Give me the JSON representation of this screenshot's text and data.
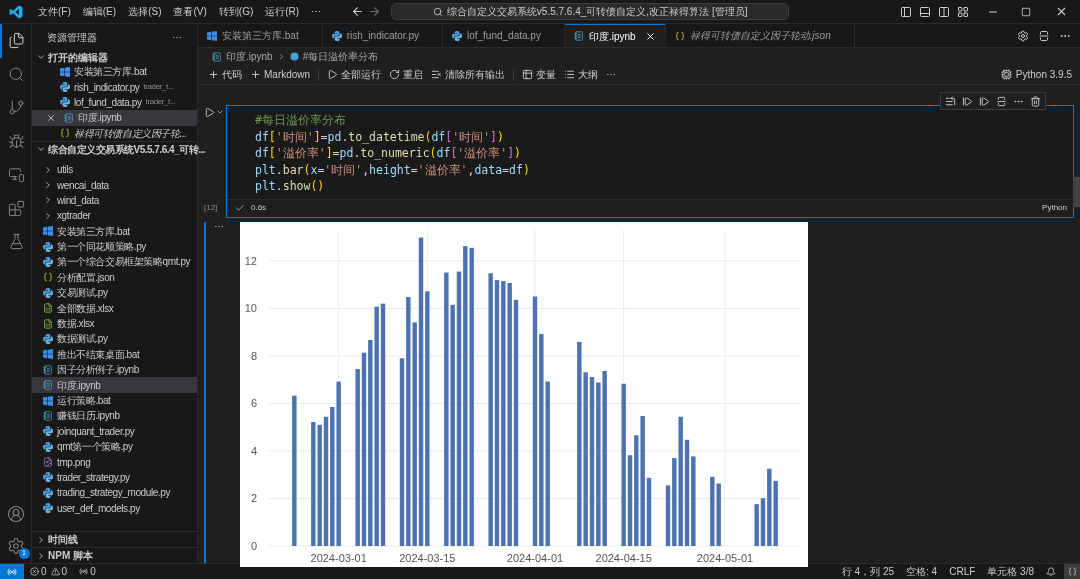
{
  "menu": [
    "文件(F)",
    "编辑(E)",
    "选择(S)",
    "查看(V)",
    "转到(G)",
    "运行(R)",
    "⋯"
  ],
  "command_center": "综合自定义交易系统v5.5.7.6.4_可转债自定义,改正禄得算法 [管理员]",
  "activity_bar": [
    {
      "kind": "explorer",
      "selected": true
    },
    {
      "kind": "search",
      "selected": false
    },
    {
      "kind": "source-control",
      "selected": false
    },
    {
      "kind": "debug",
      "selected": false
    },
    {
      "kind": "remote",
      "selected": false
    },
    {
      "kind": "extensions",
      "selected": false
    },
    {
      "kind": "testing",
      "selected": false
    }
  ],
  "settings_badge": "1",
  "sidebar": {
    "title": "资源管理器",
    "more": "⋯",
    "open_editors": {
      "title": "打开的编辑器",
      "expanded": true,
      "items": [
        {
          "name": "安装第三方库.bat",
          "kind": "bat",
          "selected": false,
          "preview": false
        },
        {
          "name": "rish_indicator.py",
          "detail": "trader_t...",
          "kind": "py",
          "selected": false,
          "preview": false
        },
        {
          "name": "lof_fund_data.py",
          "detail": "trader_t...",
          "kind": "py",
          "selected": false,
          "preview": false
        },
        {
          "name": "印度.ipynb",
          "kind": "ipynb",
          "selected": true,
          "preview": false
        },
        {
          "name": "禄得可转债自定义因子轮...",
          "kind": "json",
          "selected": false,
          "preview": true
        }
      ]
    },
    "project": {
      "title": "综合自定义交易系统V5.5.7.6.4_可转...",
      "expanded": true,
      "items": [
        {
          "name": "utils",
          "kind": "folder",
          "selected": false
        },
        {
          "name": "wencai_data",
          "kind": "folder",
          "selected": false
        },
        {
          "name": "wind_data",
          "kind": "folder",
          "selected": false
        },
        {
          "name": "xgtrader",
          "kind": "folder",
          "selected": false
        },
        {
          "name": "安装第三方库.bat",
          "kind": "bat",
          "selected": false
        },
        {
          "name": "第一个同花顺策略.py",
          "kind": "py",
          "selected": false
        },
        {
          "name": "第一个综合交易框架策略qmt.py",
          "kind": "py",
          "selected": false
        },
        {
          "name": "分析配置.json",
          "kind": "json",
          "selected": false
        },
        {
          "name": "交易测试.py",
          "kind": "py",
          "selected": false
        },
        {
          "name": "全部数据.xlsx",
          "kind": "xlsx",
          "selected": false
        },
        {
          "name": "数据.xlsx",
          "kind": "xlsx",
          "selected": false
        },
        {
          "name": "数据测试.py",
          "kind": "py",
          "selected": false
        },
        {
          "name": "推出不结束桌面.bat",
          "kind": "bat",
          "selected": false
        },
        {
          "name": "因子分析例子.ipynb",
          "kind": "ipynb",
          "selected": false
        },
        {
          "name": "印度.ipynb",
          "kind": "ipynb",
          "selected": true
        },
        {
          "name": "运行策略.bat",
          "kind": "bat",
          "selected": false
        },
        {
          "name": "赚钱日历.ipynb",
          "kind": "ipynb",
          "selected": false
        },
        {
          "name": "joinquant_trader.py",
          "kind": "py",
          "selected": false
        },
        {
          "name": "qmt第一个策略.py",
          "kind": "py",
          "selected": false
        },
        {
          "name": "tmp.png",
          "kind": "png",
          "selected": false
        },
        {
          "name": "trader_strategy.py",
          "kind": "py",
          "selected": false
        },
        {
          "name": "trading_strategy_module.py",
          "kind": "py",
          "selected": false
        },
        {
          "name": "user_def_models.py",
          "kind": "py",
          "selected": false
        }
      ]
    },
    "bottom_sections": [
      {
        "title": "时间线",
        "expanded": false
      },
      {
        "title": "NPM 脚本",
        "expanded": false
      }
    ]
  },
  "tabs": [
    {
      "label": "安装第三方库.bat",
      "kind": "bat",
      "selected": false,
      "preview": false
    },
    {
      "label": "rish_indicator.py",
      "kind": "py",
      "selected": false,
      "preview": false
    },
    {
      "label": "lof_fund_data.py",
      "kind": "py",
      "selected": false,
      "preview": false
    },
    {
      "label": "印度.ipynb",
      "kind": "ipynb",
      "selected": true,
      "preview": false
    },
    {
      "label": "禄得可转债自定义因子轮动.json",
      "kind": "json",
      "selected": false,
      "preview": true
    }
  ],
  "breadcrumb": [
    "印度.ipynb",
    "#每日溢价率分布"
  ],
  "toolbar": [
    {
      "kind": "add",
      "label": "代码"
    },
    {
      "kind": "add",
      "label": "Markdown"
    },
    {
      "kind": "run-all",
      "label": "全部运行"
    },
    {
      "kind": "restart",
      "label": "重启"
    },
    {
      "kind": "clear",
      "label": "清除所有输出"
    },
    {
      "kind": "variables",
      "label": "变量"
    },
    {
      "kind": "outline",
      "label": "大纲"
    },
    {
      "kind": "more",
      "label": "⋯"
    }
  ],
  "kernel": "Python 3.9.5",
  "cell": {
    "code": [
      "#每日溢价率分布",
      "df['时间']=pd.to_datetime(df['时间'])",
      "df['溢价率']=pd.to_numeric(df['溢价率'])",
      "plt.bar(x='时间',height='溢价率',data=df)",
      "plt.show()"
    ],
    "execution_count": "[12]",
    "success": true,
    "duration": "0.6s",
    "language": "Python",
    "output_more": "⋯"
  },
  "chart_data": {
    "type": "bar",
    "x": [
      "2024-02-23",
      "2024-02-26",
      "2024-02-27",
      "2024-02-28",
      "2024-02-29",
      "2024-03-01",
      "2024-03-04",
      "2024-03-05",
      "2024-03-06",
      "2024-03-07",
      "2024-03-08",
      "2024-03-11",
      "2024-03-12",
      "2024-03-13",
      "2024-03-14",
      "2024-03-15",
      "2024-03-18",
      "2024-03-19",
      "2024-03-20",
      "2024-03-21",
      "2024-03-22",
      "2024-03-25",
      "2024-03-26",
      "2024-03-27",
      "2024-03-28",
      "2024-03-29",
      "2024-04-01",
      "2024-04-02",
      "2024-04-03",
      "2024-04-08",
      "2024-04-09",
      "2024-04-10",
      "2024-04-11",
      "2024-04-12",
      "2024-04-15",
      "2024-04-16",
      "2024-04-17",
      "2024-04-18",
      "2024-04-19",
      "2024-04-22",
      "2024-04-23",
      "2024-04-24",
      "2024-04-25",
      "2024-04-26",
      "2024-04-29",
      "2024-04-30",
      "2024-05-06",
      "2024-05-07",
      "2024-05-08",
      "2024-05-09"
    ],
    "series": [
      {
        "color": "#4c72b0",
        "values": [
          6.33,
          5.22,
          5.1,
          5.44,
          5.85,
          6.92,
          7.45,
          8.14,
          8.67,
          10.07,
          10.2,
          7.9,
          10.48,
          9.41,
          12.98,
          10.72,
          11.51,
          10.15,
          11.55,
          12.62,
          12.55,
          11.48,
          11.19,
          11.15,
          11.07,
          10.36,
          10.5,
          8.92,
          6.92,
          8.59,
          7.31,
          7.11,
          6.88,
          7.37,
          6.83,
          3.82,
          4.66,
          5.47,
          2.87,
          2.55,
          3.7,
          5.44,
          4.47,
          3.77,
          2.91,
          2.63,
          1.76,
          2.01,
          3.25,
          2.74
        ]
      }
    ],
    "grid": true,
    "xlim": [
      "2024-02-19",
      "2024-05-13"
    ],
    "ylim": [
      0,
      13.3
    ],
    "xticks": [
      {
        "value": "2024-03-01",
        "label": "2024-03-01"
      },
      {
        "value": "2024-03-15",
        "label": "2024-03-15"
      },
      {
        "value": "2024-04-01",
        "label": "2024-04-01"
      },
      {
        "value": "2024-04-15",
        "label": "2024-04-15"
      },
      {
        "value": "2024-05-01",
        "label": "2024-05-01"
      }
    ],
    "yticks": [
      0,
      2,
      4,
      6,
      8,
      10,
      12
    ]
  },
  "status_bar": {
    "problems": [
      {
        "kind": "error",
        "count": "0"
      },
      {
        "kind": "warning",
        "count": "0"
      }
    ],
    "ports": "0",
    "position": "行 4，列 25",
    "indent": "空格: 4",
    "eol": "CRLF",
    "cell": "单元格 3/8"
  }
}
